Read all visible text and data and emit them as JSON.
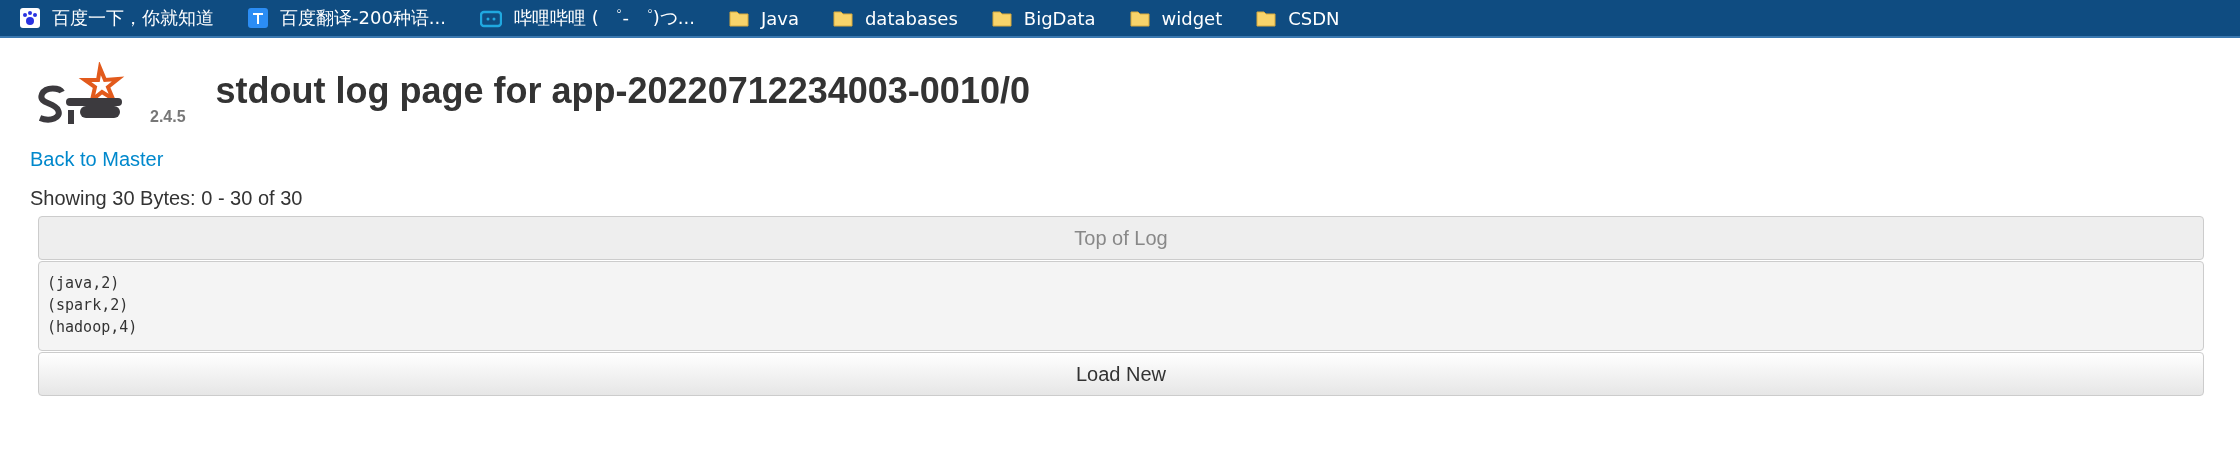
{
  "bookmarks": [
    {
      "label": "百度一下，你就知道",
      "kind": "paw"
    },
    {
      "label": "百度翻译-200种语...",
      "kind": "translate"
    },
    {
      "label": "哔哩哔哩 ( ゜- ゜)つ...",
      "kind": "tv"
    },
    {
      "label": "Java",
      "kind": "folder"
    },
    {
      "label": "databases",
      "kind": "folder"
    },
    {
      "label": "BigData",
      "kind": "folder"
    },
    {
      "label": "widget",
      "kind": "folder"
    },
    {
      "label": "CSDN",
      "kind": "folder"
    }
  ],
  "header": {
    "version": "2.4.5",
    "title": "stdout log page for app-20220712234003-0010/0"
  },
  "back_link": "Back to Master",
  "summary": "Showing 30 Bytes: 0 - 30 of 30",
  "top_button": {
    "label": "Top of Log",
    "disabled": true
  },
  "log_lines": [
    "(java,2)",
    "(spark,2)",
    "(hadoop,4)"
  ],
  "load_button": {
    "label": "Load New",
    "disabled": false
  }
}
